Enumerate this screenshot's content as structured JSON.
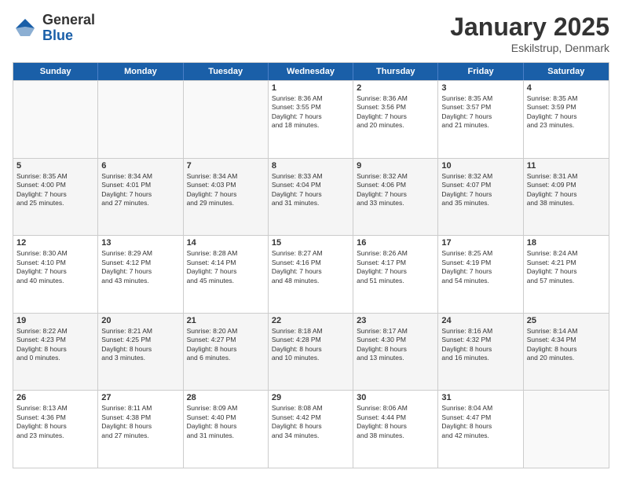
{
  "logo": {
    "general": "General",
    "blue": "Blue"
  },
  "header": {
    "title": "January 2025",
    "location": "Eskilstrup, Denmark"
  },
  "weekdays": [
    "Sunday",
    "Monday",
    "Tuesday",
    "Wednesday",
    "Thursday",
    "Friday",
    "Saturday"
  ],
  "rows": [
    [
      {
        "day": "",
        "info": ""
      },
      {
        "day": "",
        "info": ""
      },
      {
        "day": "",
        "info": ""
      },
      {
        "day": "1",
        "info": "Sunrise: 8:36 AM\nSunset: 3:55 PM\nDaylight: 7 hours\nand 18 minutes."
      },
      {
        "day": "2",
        "info": "Sunrise: 8:36 AM\nSunset: 3:56 PM\nDaylight: 7 hours\nand 20 minutes."
      },
      {
        "day": "3",
        "info": "Sunrise: 8:35 AM\nSunset: 3:57 PM\nDaylight: 7 hours\nand 21 minutes."
      },
      {
        "day": "4",
        "info": "Sunrise: 8:35 AM\nSunset: 3:59 PM\nDaylight: 7 hours\nand 23 minutes."
      }
    ],
    [
      {
        "day": "5",
        "info": "Sunrise: 8:35 AM\nSunset: 4:00 PM\nDaylight: 7 hours\nand 25 minutes."
      },
      {
        "day": "6",
        "info": "Sunrise: 8:34 AM\nSunset: 4:01 PM\nDaylight: 7 hours\nand 27 minutes."
      },
      {
        "day": "7",
        "info": "Sunrise: 8:34 AM\nSunset: 4:03 PM\nDaylight: 7 hours\nand 29 minutes."
      },
      {
        "day": "8",
        "info": "Sunrise: 8:33 AM\nSunset: 4:04 PM\nDaylight: 7 hours\nand 31 minutes."
      },
      {
        "day": "9",
        "info": "Sunrise: 8:32 AM\nSunset: 4:06 PM\nDaylight: 7 hours\nand 33 minutes."
      },
      {
        "day": "10",
        "info": "Sunrise: 8:32 AM\nSunset: 4:07 PM\nDaylight: 7 hours\nand 35 minutes."
      },
      {
        "day": "11",
        "info": "Sunrise: 8:31 AM\nSunset: 4:09 PM\nDaylight: 7 hours\nand 38 minutes."
      }
    ],
    [
      {
        "day": "12",
        "info": "Sunrise: 8:30 AM\nSunset: 4:10 PM\nDaylight: 7 hours\nand 40 minutes."
      },
      {
        "day": "13",
        "info": "Sunrise: 8:29 AM\nSunset: 4:12 PM\nDaylight: 7 hours\nand 43 minutes."
      },
      {
        "day": "14",
        "info": "Sunrise: 8:28 AM\nSunset: 4:14 PM\nDaylight: 7 hours\nand 45 minutes."
      },
      {
        "day": "15",
        "info": "Sunrise: 8:27 AM\nSunset: 4:16 PM\nDaylight: 7 hours\nand 48 minutes."
      },
      {
        "day": "16",
        "info": "Sunrise: 8:26 AM\nSunset: 4:17 PM\nDaylight: 7 hours\nand 51 minutes."
      },
      {
        "day": "17",
        "info": "Sunrise: 8:25 AM\nSunset: 4:19 PM\nDaylight: 7 hours\nand 54 minutes."
      },
      {
        "day": "18",
        "info": "Sunrise: 8:24 AM\nSunset: 4:21 PM\nDaylight: 7 hours\nand 57 minutes."
      }
    ],
    [
      {
        "day": "19",
        "info": "Sunrise: 8:22 AM\nSunset: 4:23 PM\nDaylight: 8 hours\nand 0 minutes."
      },
      {
        "day": "20",
        "info": "Sunrise: 8:21 AM\nSunset: 4:25 PM\nDaylight: 8 hours\nand 3 minutes."
      },
      {
        "day": "21",
        "info": "Sunrise: 8:20 AM\nSunset: 4:27 PM\nDaylight: 8 hours\nand 6 minutes."
      },
      {
        "day": "22",
        "info": "Sunrise: 8:18 AM\nSunset: 4:28 PM\nDaylight: 8 hours\nand 10 minutes."
      },
      {
        "day": "23",
        "info": "Sunrise: 8:17 AM\nSunset: 4:30 PM\nDaylight: 8 hours\nand 13 minutes."
      },
      {
        "day": "24",
        "info": "Sunrise: 8:16 AM\nSunset: 4:32 PM\nDaylight: 8 hours\nand 16 minutes."
      },
      {
        "day": "25",
        "info": "Sunrise: 8:14 AM\nSunset: 4:34 PM\nDaylight: 8 hours\nand 20 minutes."
      }
    ],
    [
      {
        "day": "26",
        "info": "Sunrise: 8:13 AM\nSunset: 4:36 PM\nDaylight: 8 hours\nand 23 minutes."
      },
      {
        "day": "27",
        "info": "Sunrise: 8:11 AM\nSunset: 4:38 PM\nDaylight: 8 hours\nand 27 minutes."
      },
      {
        "day": "28",
        "info": "Sunrise: 8:09 AM\nSunset: 4:40 PM\nDaylight: 8 hours\nand 31 minutes."
      },
      {
        "day": "29",
        "info": "Sunrise: 8:08 AM\nSunset: 4:42 PM\nDaylight: 8 hours\nand 34 minutes."
      },
      {
        "day": "30",
        "info": "Sunrise: 8:06 AM\nSunset: 4:44 PM\nDaylight: 8 hours\nand 38 minutes."
      },
      {
        "day": "31",
        "info": "Sunrise: 8:04 AM\nSunset: 4:47 PM\nDaylight: 8 hours\nand 42 minutes."
      },
      {
        "day": "",
        "info": ""
      }
    ]
  ],
  "colors": {
    "header_bg": "#1a5fa8",
    "header_text": "#ffffff",
    "border": "#cccccc",
    "alt_bg": "#f5f5f5",
    "empty_bg": "#f9f9f9"
  }
}
